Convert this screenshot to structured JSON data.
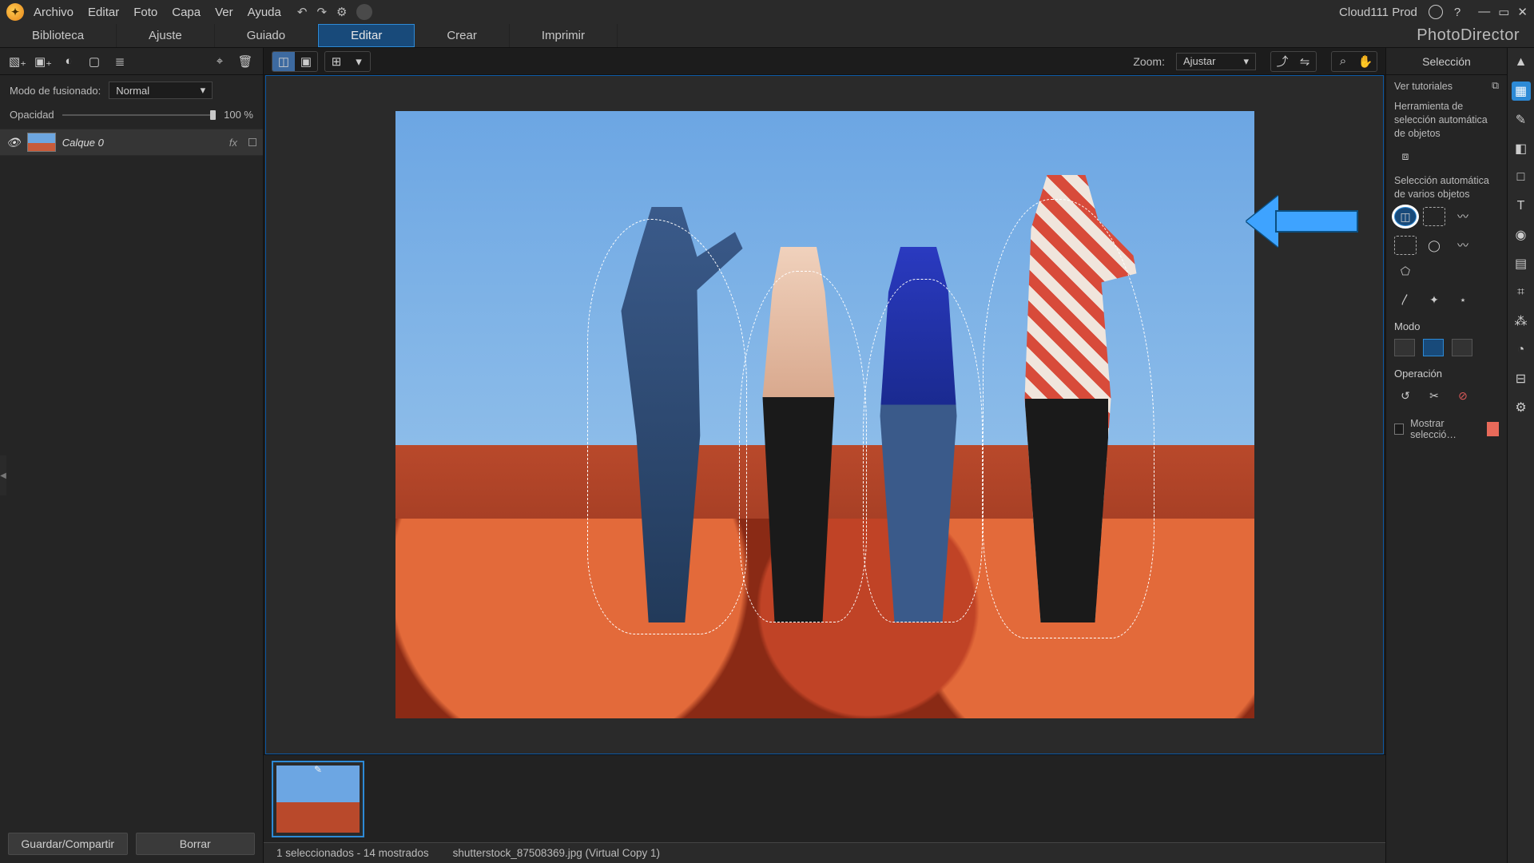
{
  "menu": {
    "items": [
      "Archivo",
      "Editar",
      "Foto",
      "Capa",
      "Ver",
      "Ayuda"
    ]
  },
  "title_right": {
    "account": "Cloud111 Prod"
  },
  "modes": {
    "items": [
      "Biblioteca",
      "Ajuste",
      "Guiado",
      "Editar",
      "Crear",
      "Imprimir"
    ],
    "active": 3
  },
  "brand": "PhotoDirector",
  "left": {
    "blend_label": "Modo de fusionado:",
    "blend_value": "Normal",
    "opacity_label": "Opacidad",
    "opacity_value": "100 %",
    "layer_name": "Calque 0",
    "layer_fx": "fx",
    "save_share": "Guardar/Compartir",
    "delete": "Borrar"
  },
  "center": {
    "zoom_label": "Zoom:",
    "zoom_value": "Ajustar"
  },
  "status": {
    "selection": "1 seleccionados - 14 mostrados",
    "filename": "shutterstock_87508369.jpg (Virtual Copy 1)"
  },
  "right": {
    "title": "Selección",
    "tutorials": "Ver tutoriales",
    "tool_auto_object": "Herramienta de selección automática de objetos",
    "tool_auto_multi": "Selección automática de varios objetos",
    "mode_label": "Modo",
    "operation_label": "Operación",
    "show_selection": "Mostrar selecció…"
  },
  "icons": {
    "undo": "↶",
    "redo": "↷",
    "gear": "⚙",
    "bell": "◐",
    "help": "?",
    "min": "—",
    "max": "▭",
    "close": "✕",
    "add_layer": "▧₊",
    "add_image": "▣₊",
    "adjust": "◐",
    "mask": "▢",
    "menu2": "≣",
    "filter": "⌖",
    "trash": "🗑",
    "compare_a": "◫",
    "compare_b": "▣",
    "grid": "⊞",
    "caret": "▾",
    "export": "⤴",
    "flip": "⇋",
    "zoom": "⌕",
    "hand": "✋",
    "popout": "⧉",
    "ai_obj": "⧈",
    "rect": "▭",
    "ellipse": "◯",
    "lasso": "〰",
    "poly": "⬠",
    "brush": "〳",
    "magic": "✦",
    "wand": "⋆",
    "m_new": "■",
    "m_add": "⊞",
    "m_sub": "⊟",
    "op_inv": "↺",
    "op_cut": "✂",
    "op_clear": "⊘",
    "pointer": "▲",
    "sel": "▦",
    "pen": "✎",
    "eraser": "◧",
    "shape": "□",
    "text": "T",
    "fill": "◉",
    "swatches": "▤",
    "crop": "⌗",
    "fx": "⁂",
    "clock": "◔",
    "ruler": "⊟",
    "settings": "⚙"
  }
}
